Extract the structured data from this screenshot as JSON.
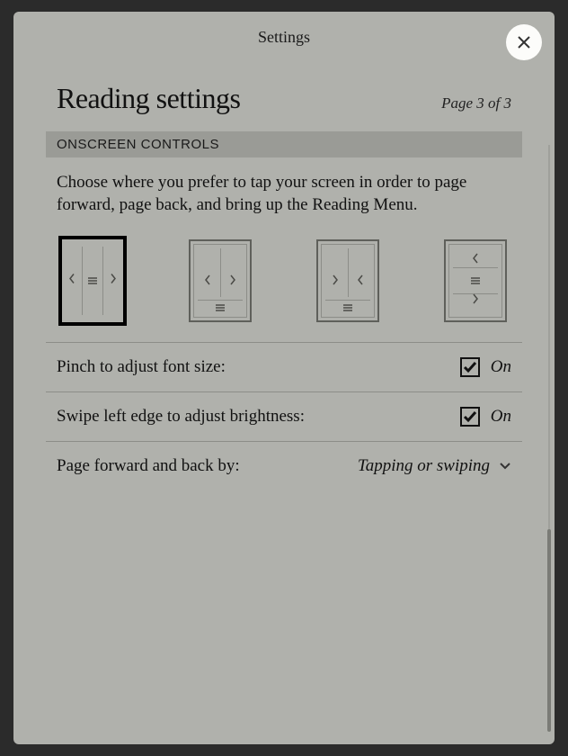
{
  "modal_title": "Settings",
  "section_title": "Reading settings",
  "page_indicator": "Page 3 of 3",
  "section_header": "ONSCREEN CONTROLS",
  "description": "Choose where you prefer to tap your screen in order to page forward, page back, and bring up the Reading Menu.",
  "layout_options": {
    "selected_index": 0,
    "options": [
      {
        "id": "three-column",
        "name": "layout-three-column"
      },
      {
        "id": "two-col-bottom",
        "name": "layout-two-col-bottom"
      },
      {
        "id": "two-col-bottom-rev",
        "name": "layout-two-col-bottom-reversed"
      },
      {
        "id": "three-row",
        "name": "layout-three-row"
      }
    ]
  },
  "rows": {
    "pinch": {
      "label": "Pinch to adjust font size:",
      "state": "On",
      "checked": true
    },
    "swipe": {
      "label": "Swipe left edge to adjust brightness:",
      "state": "On",
      "checked": true
    },
    "paging": {
      "label": "Page forward and back by:",
      "value": "Tapping or swiping"
    }
  }
}
